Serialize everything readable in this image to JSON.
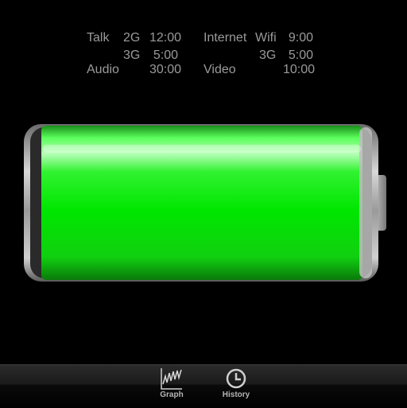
{
  "usage": {
    "talk": {
      "label": "Talk",
      "g2_label": "2G",
      "g2_time": "12:00",
      "g3_label": "3G",
      "g3_time": "5:00"
    },
    "internet": {
      "label": "Internet",
      "wifi_label": "Wifi",
      "wifi_time": "9:00",
      "g3_label": "3G",
      "g3_time": "5:00"
    },
    "audio": {
      "label": "Audio",
      "time": "30:00"
    },
    "video": {
      "label": "Video",
      "time": "10:00"
    }
  },
  "battery": {
    "charge_fraction": 1.0,
    "fill_color": "#00e600"
  },
  "tabs": [
    {
      "label": "Graph",
      "icon": "graph-icon"
    },
    {
      "label": "History",
      "icon": "clock-icon"
    }
  ]
}
